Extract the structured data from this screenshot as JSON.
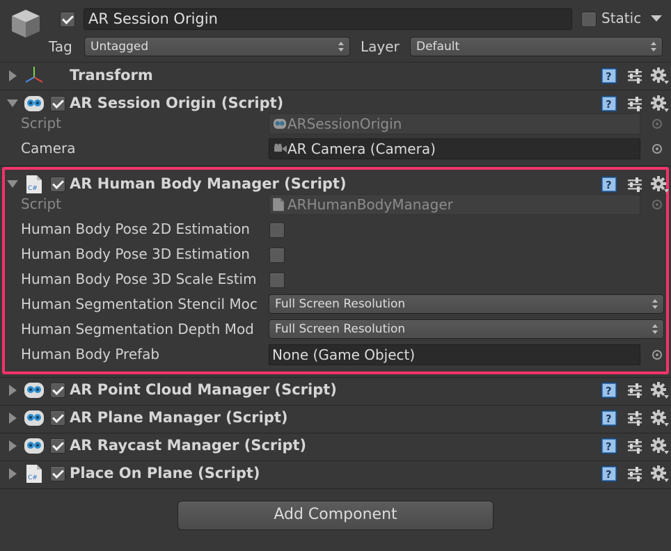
{
  "header": {
    "object_name": "AR Session Origin",
    "static_label": "Static",
    "tag_label": "Tag",
    "tag_value": "Untagged",
    "layer_label": "Layer",
    "layer_value": "Default"
  },
  "components": {
    "transform": {
      "title": "Transform"
    },
    "session_origin": {
      "title": "AR Session Origin (Script)",
      "script_label": "Script",
      "script_value": "ARSessionOrigin",
      "camera_label": "Camera",
      "camera_value": "AR Camera (Camera)"
    },
    "human_body": {
      "title": "AR Human Body Manager (Script)",
      "script_label": "Script",
      "script_value": "ARHumanBodyManager",
      "pose2d_label": "Human Body Pose 2D Estimation",
      "pose3d_label": "Human Body Pose 3D Estimation",
      "pose3d_scale_label": "Human Body Pose 3D Scale Estim",
      "stencil_label": "Human Segmentation Stencil Moc",
      "stencil_value": "Full Screen Resolution",
      "depth_label": "Human Segmentation Depth Mod",
      "depth_value": "Full Screen Resolution",
      "prefab_label": "Human Body Prefab",
      "prefab_value": "None (Game Object)"
    },
    "point_cloud": {
      "title": "AR Point Cloud Manager (Script)"
    },
    "plane": {
      "title": "AR Plane Manager (Script)"
    },
    "raycast": {
      "title": "AR Raycast Manager (Script)"
    },
    "place_on_plane": {
      "title": "Place On Plane (Script)"
    }
  },
  "csharp_icon_text": "C#",
  "add_component_label": "Add Component",
  "colors": {
    "highlight": "#f2336a",
    "background": "#383838"
  }
}
